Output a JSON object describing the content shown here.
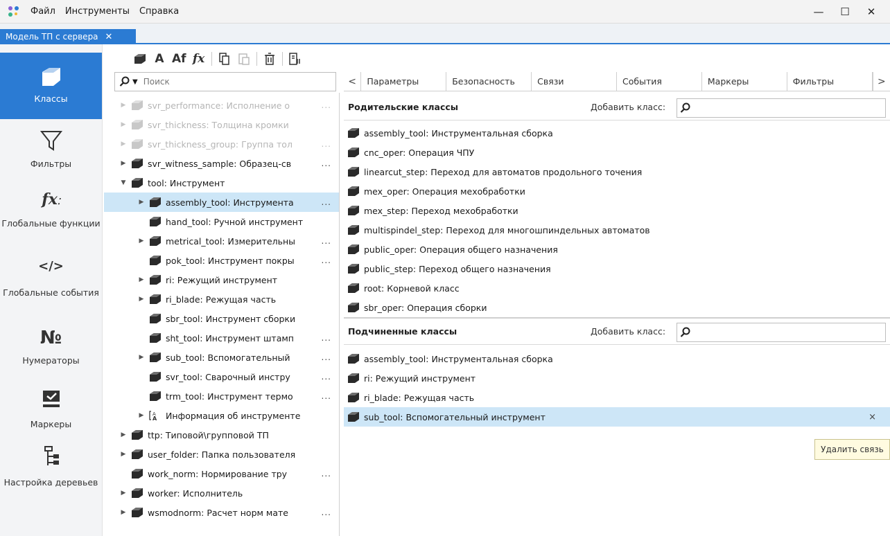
{
  "menu": [
    "Файл",
    "Инструменты",
    "Справка"
  ],
  "window_controls": {
    "minimize": "—",
    "maximize": "☐",
    "close": "✕"
  },
  "doc_tab": {
    "label": "Модель ТП с сервера",
    "close": "✕"
  },
  "nav": [
    {
      "label": "Классы",
      "icon": "class-icon",
      "active": true
    },
    {
      "label": "Фильтры",
      "icon": "filter-icon"
    },
    {
      "label": "Глобальные функции",
      "icon": "fx-icon"
    },
    {
      "label": "Глобальные события",
      "icon": "code-icon",
      "glyph": "</>"
    },
    {
      "label": "Нумераторы",
      "icon": "numero-icon",
      "glyph": "№"
    },
    {
      "label": "Маркеры",
      "icon": "marker-icon"
    },
    {
      "label": "Настройка деревьев",
      "icon": "tree-settings-icon"
    }
  ],
  "toolbar": {
    "a": "A",
    "af": "Af",
    "fx": "fx"
  },
  "search": {
    "placeholder": "Поиск"
  },
  "tree": [
    {
      "label": "svr_performance: Исполнение о",
      "expand": true,
      "faded": true,
      "more": true
    },
    {
      "label": "svr_thickness: Толщина кромки",
      "expand": true,
      "faded": true
    },
    {
      "label": "svr_thickness_group: Группа тол",
      "expand": true,
      "faded": true,
      "more": true
    },
    {
      "label": "svr_witness_sample: Образец-св",
      "expand": true,
      "more": true
    },
    {
      "label": "tool: Инструмент",
      "expanded": true
    },
    {
      "label": "assembly_tool: Инструмента",
      "expand": true,
      "child": true,
      "selected": true,
      "more": true
    },
    {
      "label": "hand_tool: Ручной инструмент",
      "child": true
    },
    {
      "label": "metrical_tool: Измерительны",
      "expand": true,
      "child": true,
      "more": true
    },
    {
      "label": "pok_tool: Инструмент покры",
      "child": true,
      "more": true
    },
    {
      "label": "ri: Режущий инструмент",
      "expand": true,
      "child": true
    },
    {
      "label": "ri_blade: Режущая часть",
      "expand": true,
      "child": true
    },
    {
      "label": "sbr_tool: Инструмент сборки",
      "child": true
    },
    {
      "label": "sht_tool: Инструмент штамп",
      "child": true,
      "more": true
    },
    {
      "label": "sub_tool: Вспомогательный",
      "expand": true,
      "child": true,
      "more": true
    },
    {
      "label": "svr_tool: Сварочный инстру",
      "child": true,
      "more": true
    },
    {
      "label": "trm_tool: Инструмент термо",
      "child": true,
      "more": true
    },
    {
      "label": "Информация об инструменте",
      "expand": true,
      "child": true,
      "attr": true
    },
    {
      "label": "ttp: Типовой\\групповой ТП",
      "expand": true
    },
    {
      "label": "user_folder: Папка пользователя",
      "expand": true
    },
    {
      "label": "work_norm: Нормирование тру",
      "more": true
    },
    {
      "label": "worker: Исполнитель",
      "expand": true
    },
    {
      "label": "wsmodnorm: Расчет норм мате",
      "expand": true,
      "more": true
    }
  ],
  "tabs": [
    "Параметры",
    "Безопасность",
    "Связи",
    "События",
    "Маркеры",
    "Фильтры"
  ],
  "tabs_nav": {
    "prev": "<",
    "next": ">"
  },
  "parent_section": {
    "title": "Родительские классы",
    "add_label": "Добавить класс:",
    "items": [
      "assembly_tool: Инструментальная сборка",
      "cnc_oper: Операция ЧПУ",
      "linearcut_step: Переход для автоматов продольного точения",
      "mex_oper: Операция мехобработки",
      "mex_step: Переход мехобработки",
      "multispindel_step: Переход для многошпиндельных автоматов",
      "public_oper: Операция общего назначения",
      "public_step: Переход общего назначения",
      "root: Корневой класс",
      "sbr_oper: Операция сборки"
    ]
  },
  "child_section": {
    "title": "Подчиненные классы",
    "add_label": "Добавить класс:",
    "items": [
      "assembly_tool: Инструментальная сборка",
      "ri: Режущий инструмент",
      "ri_blade: Режущая часть",
      "sub_tool: Вспомогательный инструмент"
    ],
    "remove": "×"
  },
  "tooltip": "Удалить связь",
  "colors": {
    "accent": "#2b7bd3",
    "selected_row": "#cde6f7"
  }
}
